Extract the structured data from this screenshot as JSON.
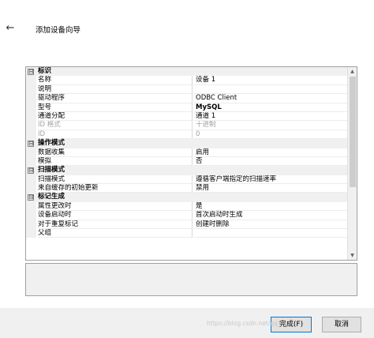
{
  "header": {
    "back_icon": "arrow-left-icon",
    "title": "添加设备向导"
  },
  "property_grid": {
    "categories": [
      {
        "label": "标识",
        "properties": [
          {
            "name": "名称",
            "value": "设备 1",
            "disabled": false
          },
          {
            "name": "说明",
            "value": "",
            "disabled": false
          },
          {
            "name": "驱动程序",
            "value": "ODBC Client",
            "disabled": false
          },
          {
            "name": "型号",
            "value": "MySQL",
            "disabled": false,
            "bold": true
          },
          {
            "name": "通道分配",
            "value": "通道 1",
            "disabled": false
          },
          {
            "name": "ID 格式",
            "value": "十进制",
            "disabled": true
          },
          {
            "name": "ID",
            "value": "0",
            "disabled": true
          }
        ]
      },
      {
        "label": "操作模式",
        "properties": [
          {
            "name": "数据收集",
            "value": "启用",
            "disabled": false
          },
          {
            "name": "模拟",
            "value": "否",
            "disabled": false
          }
        ]
      },
      {
        "label": "扫描模式",
        "properties": [
          {
            "name": "扫描模式",
            "value": "遵循客户端指定的扫描速率",
            "disabled": false
          },
          {
            "name": "来自缓存的初始更新",
            "value": "禁用",
            "disabled": false
          }
        ]
      },
      {
        "label": "标记生成",
        "properties": [
          {
            "name": "属性更改时",
            "value": "是",
            "disabled": false
          },
          {
            "name": "设备启动时",
            "value": "首次启动时生成",
            "disabled": false
          },
          {
            "name": "对于重复标记",
            "value": "创建时删除",
            "disabled": false
          },
          {
            "name": "父组",
            "value": "",
            "disabled": false
          }
        ]
      }
    ],
    "collapse_icon": "⊟"
  },
  "footer": {
    "finish_label": "完成(F)",
    "cancel_label": "取消"
  },
  "watermark": "https://blog.csdn.net/qq_"
}
